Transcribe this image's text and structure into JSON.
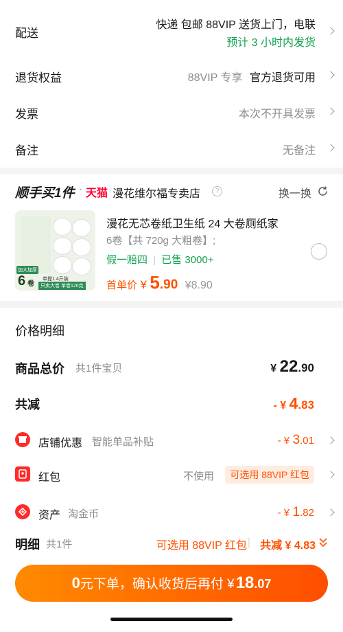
{
  "delivery": {
    "label": "配送",
    "line1": "快递 包邮 88VIP 送货上门，电联",
    "line2": "预计 3 小时内发货"
  },
  "returns": {
    "label": "退货权益",
    "tag": "88VIP 专享",
    "value": "官方退货可用"
  },
  "invoice": {
    "label": "发票",
    "value": "本次不开具发票"
  },
  "note": {
    "label": "备注",
    "value": "无备注"
  },
  "shop": {
    "brand_title": "顺手买1件",
    "dot": "·",
    "tmall": "天猫",
    "name": "漫花维尔福专卖店",
    "info_icon": "?",
    "swap_label": "换一换"
  },
  "product": {
    "title": "漫花无芯卷纸卫生纸 24 大卷厕纸家",
    "spec": "6卷【共 720g 大粗卷】;",
    "guarantee": "假一赔四",
    "sold": "已售 3000+",
    "first_label": "首单价",
    "currency": "¥",
    "price_int": "5",
    "price_dec": ".90",
    "orig_price": "¥8.90",
    "img_count": "6",
    "img_unit": "卷",
    "img_caption1": "单提1.4斤装",
    "img_caption2": "只卖大卷 单卷120克",
    "img_tag": "加大加厚"
  },
  "price_detail": {
    "title": "价格明细",
    "total_label": "商品总价",
    "total_sub": "共1件宝贝",
    "total_currency": "¥",
    "total_int": "22",
    "total_dec": ".90",
    "reduce_label": "共减",
    "reduce_prefix": "- ¥",
    "reduce_int": "4",
    "reduce_dec": ".83",
    "shop_label": "店铺优惠",
    "shop_sub": "智能单品补贴",
    "shop_prefix": "- ¥",
    "shop_int": "3",
    "shop_dec": ".01",
    "hongbao_label": "红包",
    "hongbao_status": "不使用",
    "hongbao_badge": "可选用 88VIP 红包",
    "asset_label": "资产",
    "asset_sub": "淘金币",
    "asset_prefix": "- ¥",
    "asset_int": "1",
    "asset_dec": ".82"
  },
  "footer": {
    "detail_label": "明细",
    "detail_sub": "共1件",
    "hongbao_link": "可选用 88VIP 红包",
    "reduce_text": "共减 ¥ 4.83",
    "pay_prefix": "0",
    "pay_text": "元下单，确认收货后再付 ¥",
    "pay_int": "18",
    "pay_dec": ".07"
  },
  "colors": {
    "accent": "#ff5000",
    "green": "#12a150",
    "tmall_red": "#ff0036"
  }
}
